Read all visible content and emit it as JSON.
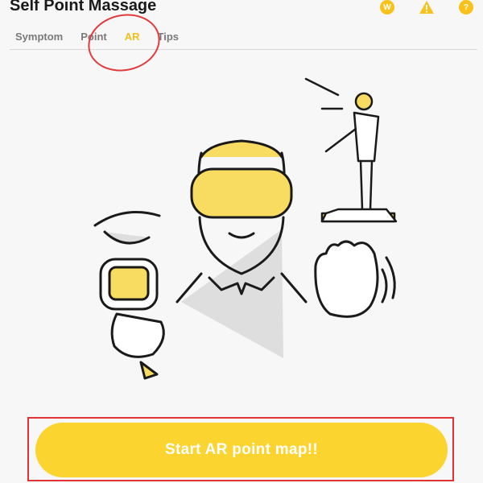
{
  "header": {
    "title": "Self Point Massage",
    "icons": [
      {
        "name": "wallet-icon",
        "glyph": "W"
      },
      {
        "name": "warning-icon",
        "glyph": "!"
      },
      {
        "name": "help-icon",
        "glyph": "?"
      }
    ]
  },
  "tabs": [
    {
      "label": "Symptom",
      "active": false
    },
    {
      "label": "Point",
      "active": false
    },
    {
      "label": "AR",
      "active": true
    },
    {
      "label": "Tips",
      "active": false
    }
  ],
  "cta": {
    "label": "Start AR point map!!"
  },
  "colors": {
    "accent": "#f8c21a",
    "cta_background": "#fbd42f",
    "annotation": "#e33b3b"
  }
}
